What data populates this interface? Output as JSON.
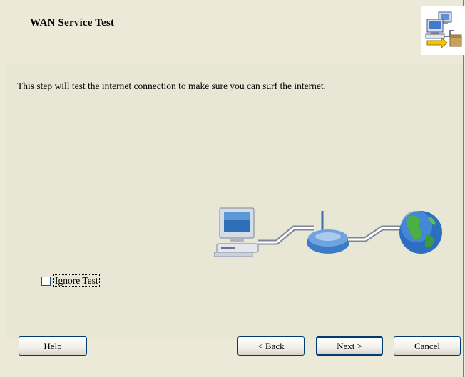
{
  "header": {
    "title": "WAN Service Test",
    "icon": "network-wizard-icon"
  },
  "main": {
    "description": "This step will test the internet connection to make sure you can surf the internet.",
    "illustration": [
      "computer-icon",
      "router-icon",
      "globe-icon"
    ],
    "ignore_test": {
      "label": "Ignore Test",
      "checked": false
    }
  },
  "buttons": {
    "help": "Help",
    "back": "< Back",
    "next": "Next >",
    "cancel": "Cancel"
  },
  "colors": {
    "background": "#ECE9D8",
    "button_border": "#003C74"
  }
}
